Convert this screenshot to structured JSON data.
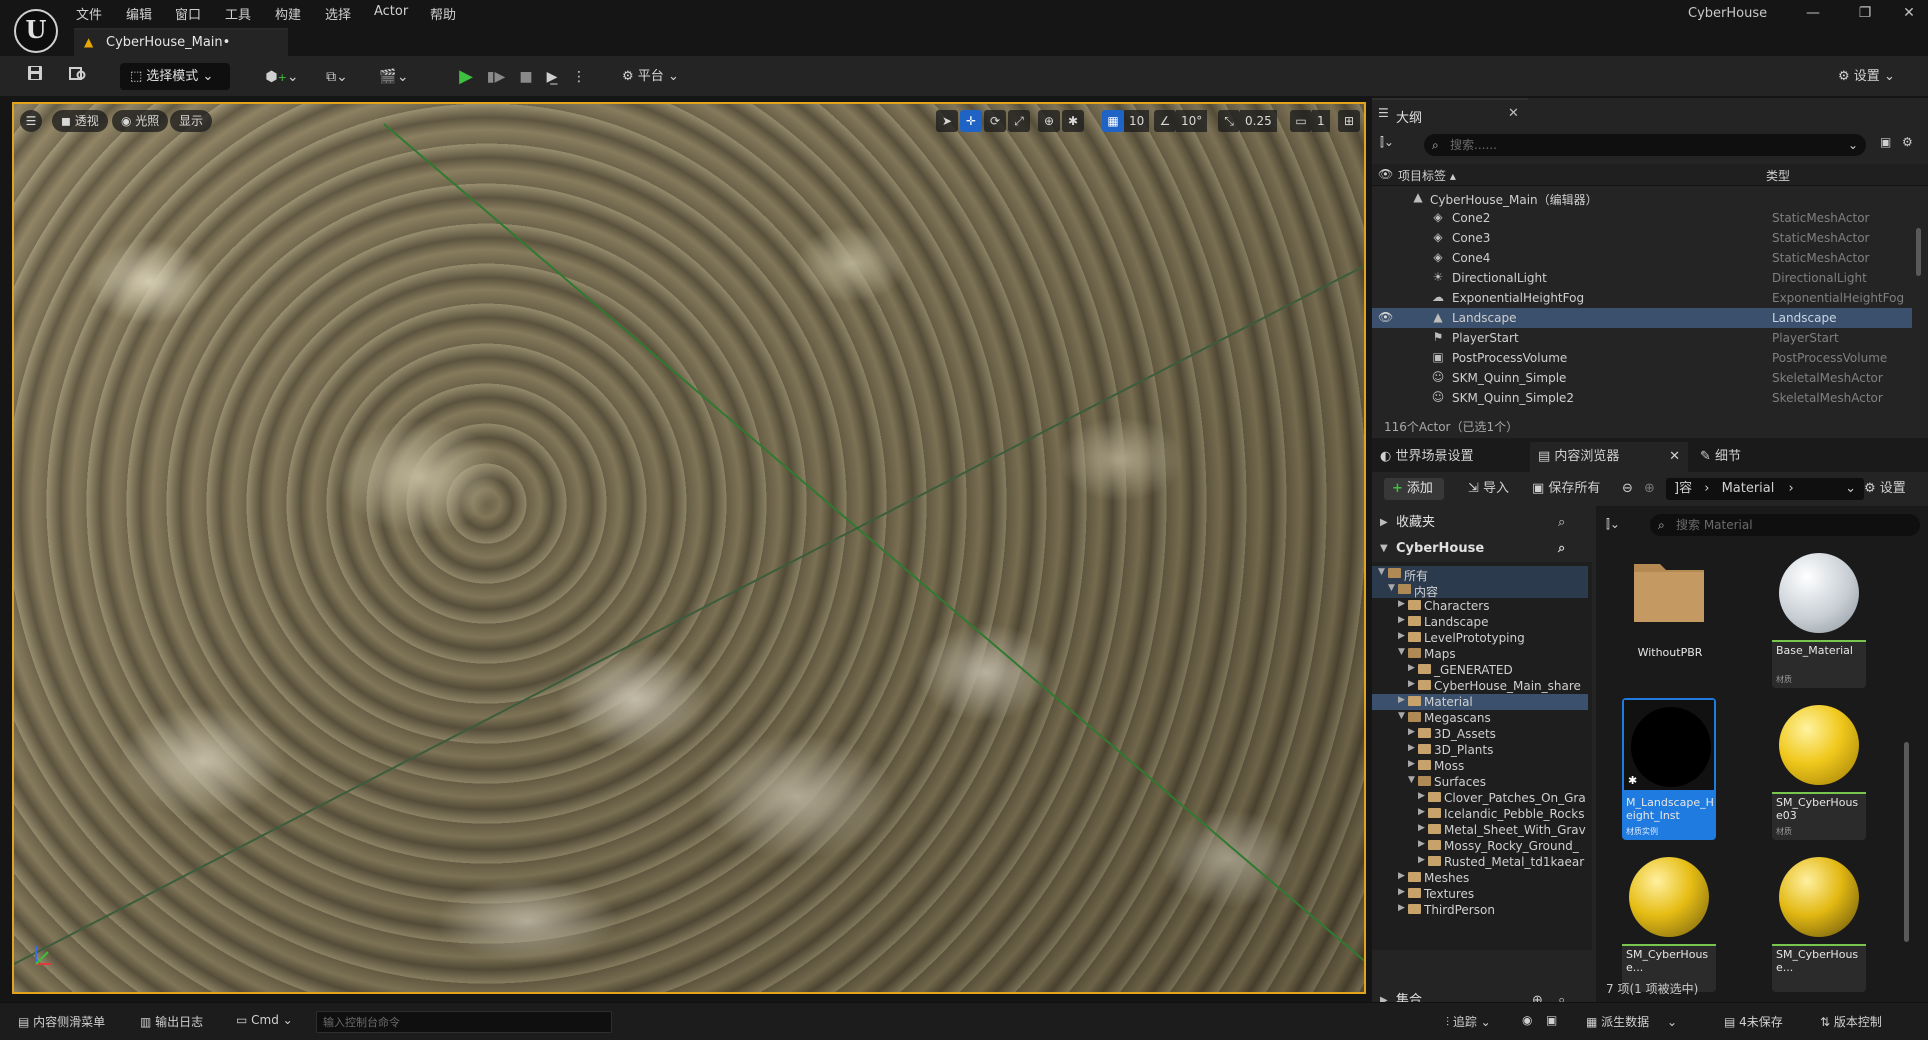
{
  "window": {
    "project_name": "CyberHouse",
    "minimize": "—",
    "restore": "❐",
    "close": "✕"
  },
  "menu": [
    "文件",
    "编辑",
    "窗口",
    "工具",
    "构建",
    "选择",
    "Actor",
    "帮助"
  ],
  "doc_tab": {
    "label": "CyberHouse_Main•"
  },
  "toolbar": {
    "mode_select": "选择模式",
    "platform": "平台",
    "settings": "设置"
  },
  "viewport": {
    "perspective": "透视",
    "lighting": "光照",
    "show": "显示",
    "grid_snap": "10",
    "rotate_snap": "10°",
    "scale_snap": "0.25",
    "camera_speed": "1"
  },
  "outliner": {
    "tab_label": "大纲",
    "search_placeholder": "搜索......",
    "col_label": "项目标签 ▴",
    "col_type": "类型",
    "root": "CyberHouse_Main（编辑器）",
    "rows": [
      {
        "name": "Cone2",
        "type": "StaticMeshActor",
        "icon": "◈"
      },
      {
        "name": "Cone3",
        "type": "StaticMeshActor",
        "icon": "◈"
      },
      {
        "name": "Cone4",
        "type": "StaticMeshActor",
        "icon": "◈"
      },
      {
        "name": "DirectionalLight",
        "type": "DirectionalLight",
        "icon": "☀"
      },
      {
        "name": "ExponentialHeightFog",
        "type": "ExponentialHeightFog",
        "icon": "☁"
      },
      {
        "name": "Landscape",
        "type": "Landscape",
        "icon": "▲"
      },
      {
        "name": "PlayerStart",
        "type": "PlayerStart",
        "icon": "⚑"
      },
      {
        "name": "PostProcessVolume",
        "type": "PostProcessVolume",
        "icon": "▣"
      },
      {
        "name": "SKM_Quinn_Simple",
        "type": "SkeletalMeshActor",
        "icon": "☺"
      },
      {
        "name": "SKM_Quinn_Simple2",
        "type": "SkeletalMeshActor",
        "icon": "☺"
      }
    ],
    "footer": "116个Actor（已选1个）"
  },
  "lower_tabs": {
    "world_settings": "世界场景设置",
    "content_browser": "内容浏览器",
    "details": "细节"
  },
  "content_browser": {
    "add": "添加",
    "import": "导入",
    "save_all": "保存所有",
    "path_prefix": "]容",
    "path_current": "Material",
    "settings": "设置",
    "favorites": "收藏夹",
    "project": "CyberHouse",
    "collections": "集合",
    "search_placeholder": "搜索 Material",
    "tree": [
      {
        "label": "所有",
        "indent": 0,
        "open": true
      },
      {
        "label": "内容",
        "indent": 1,
        "open": true
      },
      {
        "label": "Characters",
        "indent": 2,
        "open": false
      },
      {
        "label": "Landscape",
        "indent": 2,
        "open": false
      },
      {
        "label": "LevelPrototyping",
        "indent": 2,
        "open": false
      },
      {
        "label": "Maps",
        "indent": 2,
        "open": true
      },
      {
        "label": "_GENERATED",
        "indent": 3,
        "open": false
      },
      {
        "label": "CyberHouse_Main_share",
        "indent": 3,
        "open": false
      },
      {
        "label": "Material",
        "indent": 2,
        "open": false
      },
      {
        "label": "Megascans",
        "indent": 2,
        "open": true
      },
      {
        "label": "3D_Assets",
        "indent": 3,
        "open": false
      },
      {
        "label": "3D_Plants",
        "indent": 3,
        "open": false
      },
      {
        "label": "Moss",
        "indent": 3,
        "open": false
      },
      {
        "label": "Surfaces",
        "indent": 3,
        "open": true
      },
      {
        "label": "Clover_Patches_On_Gra",
        "indent": 4,
        "open": false
      },
      {
        "label": "Icelandic_Pebble_Rocks",
        "indent": 4,
        "open": false
      },
      {
        "label": "Metal_Sheet_With_Grav",
        "indent": 4,
        "open": false
      },
      {
        "label": "Mossy_Rocky_Ground_",
        "indent": 4,
        "open": false
      },
      {
        "label": "Rusted_Metal_td1kaear",
        "indent": 4,
        "open": false
      },
      {
        "label": "Meshes",
        "indent": 2,
        "open": false
      },
      {
        "label": "Textures",
        "indent": 2,
        "open": false
      },
      {
        "label": "ThirdPerson",
        "indent": 2,
        "open": false
      }
    ],
    "assets": [
      {
        "name": "WithoutPBR",
        "type": ""
      },
      {
        "name": "Base_Material",
        "type": "材质"
      },
      {
        "name": "M_Landscape_Height_Inst",
        "type": "材质实例"
      },
      {
        "name": "SM_CyberHouse03",
        "type": "材质"
      },
      {
        "name": "SM_CyberHouse...",
        "type": ""
      },
      {
        "name": "SM_CyberHouse...",
        "type": ""
      }
    ],
    "footer": "7 项(1 项被选中)"
  },
  "statusbar": {
    "content_drawer": "内容侧滑菜单",
    "output_log": "输出日志",
    "cmd": "Cmd",
    "console_placeholder": "输入控制台命令",
    "trace": "追踪",
    "derived_data": "派生数据",
    "unsaved": "4未保存",
    "source_control": "版本控制"
  },
  "colors": {
    "accent": "#e3a31b",
    "selection": "#3b506c",
    "play_green": "#3fbf3f"
  }
}
